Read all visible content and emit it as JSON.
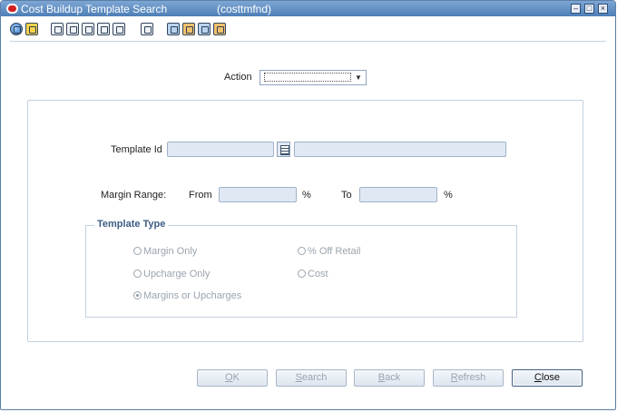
{
  "window": {
    "title": "Cost Buildup Template Search",
    "code": "(costtmfnd)",
    "controls": [
      "minimize",
      "maximize",
      "close"
    ]
  },
  "toolbar": {
    "icons": [
      "globe-icon",
      "favorite-icon",
      "clock-icon",
      "spellcheck-icon",
      "copy-icon",
      "print-icon",
      "help-icon",
      "note-icon",
      "filter-icon",
      "data-icon",
      "chart-icon",
      "find-icon"
    ]
  },
  "form": {
    "action_label": "Action",
    "template_id_label": "Template Id",
    "margin_range_label": "Margin Range:",
    "from_label": "From",
    "percent1": "%",
    "to_label": "To",
    "percent2": "%",
    "template_type_legend": "Template Type",
    "radios": {
      "margin_only": "Margin Only",
      "off_retail": "% Off Retail",
      "upcharge_only": "Upcharge Only",
      "cost": "Cost",
      "margins_or_upcharges": "Margins or Upcharges"
    },
    "selected_radio": "Margins or Upcharges"
  },
  "buttons": {
    "ok": {
      "first": "O",
      "rest": "K"
    },
    "search": {
      "first": "S",
      "rest": "earch"
    },
    "back": {
      "first": "B",
      "rest": "ack"
    },
    "refresh": {
      "first": "R",
      "rest": "efresh"
    },
    "close": {
      "first": "C",
      "rest": "lose"
    }
  },
  "colors": {
    "titlebar": "#4e7fb7",
    "field_bg": "#dfe8f3",
    "legend": "#3d5d84",
    "disabled_text": "#9aa4ae"
  }
}
